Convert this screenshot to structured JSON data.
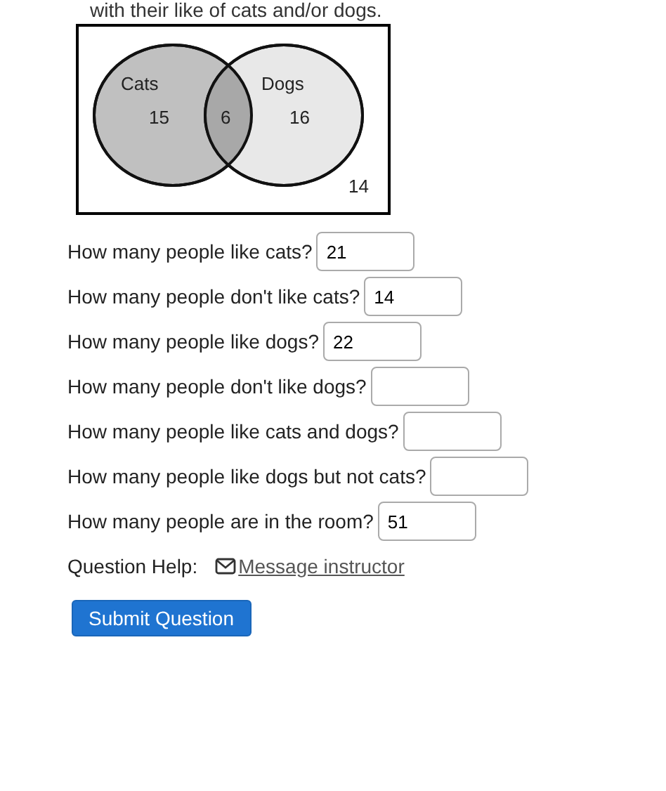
{
  "intro": "with their like of cats and/or dogs.",
  "venn": {
    "sets": [
      {
        "label": "Cats",
        "count": "15"
      },
      {
        "label": "Dogs",
        "count": "16"
      }
    ],
    "overlap": "6",
    "outside": "14"
  },
  "questions": [
    {
      "prompt": "How many people like cats?",
      "value": "21"
    },
    {
      "prompt": "How many people don't like cats?",
      "value": "14"
    },
    {
      "prompt": "How many people like dogs?",
      "value": "22"
    },
    {
      "prompt": "How many people don't like dogs?"
    },
    {
      "prompt": "How many people like cats and dogs?"
    },
    {
      "prompt": "How many people like dogs but not cats?"
    },
    {
      "prompt": "How many people are in the room?",
      "value": "51"
    }
  ],
  "help": {
    "label": "Question Help:",
    "link": "Message instructor"
  },
  "submit": "Submit Question"
}
